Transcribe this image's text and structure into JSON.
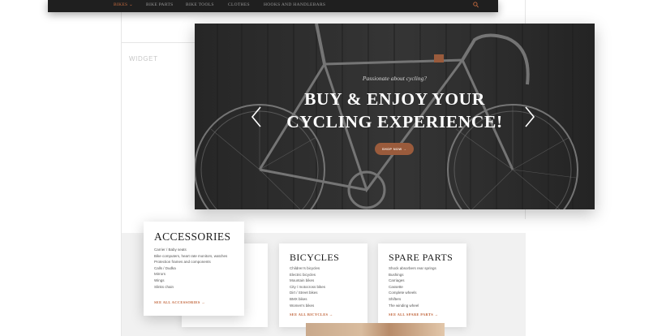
{
  "nav": {
    "items": [
      {
        "label": "Bikes ⌄",
        "active": true
      },
      {
        "label": "Bike Parts",
        "active": false
      },
      {
        "label": "Bike Tools",
        "active": false
      },
      {
        "label": "Clothes",
        "active": false
      },
      {
        "label": "Hooks and Handlebars",
        "active": false
      }
    ],
    "search_icon": "search-icon"
  },
  "widget_label": "WIDGET",
  "hero": {
    "tagline": "Passionate about cycling?",
    "title_line1": "BUY & ENJOY YOUR",
    "title_line2": "CYCLING EXPERIENCE!",
    "button_label": "SHOP NOW →",
    "prev_icon": "chevron-left-icon",
    "next_icon": "chevron-right-icon"
  },
  "accessories": {
    "title": "ACCESSORIES",
    "items": [
      "Carrier / Baby seats",
      "Bike computers, heart rate monitors, watches",
      "Protection frames and components",
      "Calls / Dudka",
      "Mirrors",
      "Wings",
      "Slinks chain"
    ],
    "link": "SEE ALL ACCESSORIES →"
  },
  "bicycles": {
    "title": "BICYCLES",
    "items": [
      "Children's bicycles",
      "Electric bicycles",
      "Mountain bikes",
      "City / motocross bikes",
      "Dirt / Street bikes",
      "BMX bikes",
      "Women's bikes"
    ],
    "link": "SEE ALL BICYCLES →"
  },
  "spare_parts": {
    "title": "SPARE PARTS",
    "items": [
      "Shock absorbers rear springs",
      "Bushings",
      "Carriages",
      "Cassette",
      "Complete wheels",
      "Shifters",
      "The winding wheel"
    ],
    "link": "SEE ALL SPARE PARTS →"
  },
  "colors": {
    "accent": "#c0643a",
    "nav_bg": "#1f1f1f",
    "button": "#9a5b3c"
  }
}
